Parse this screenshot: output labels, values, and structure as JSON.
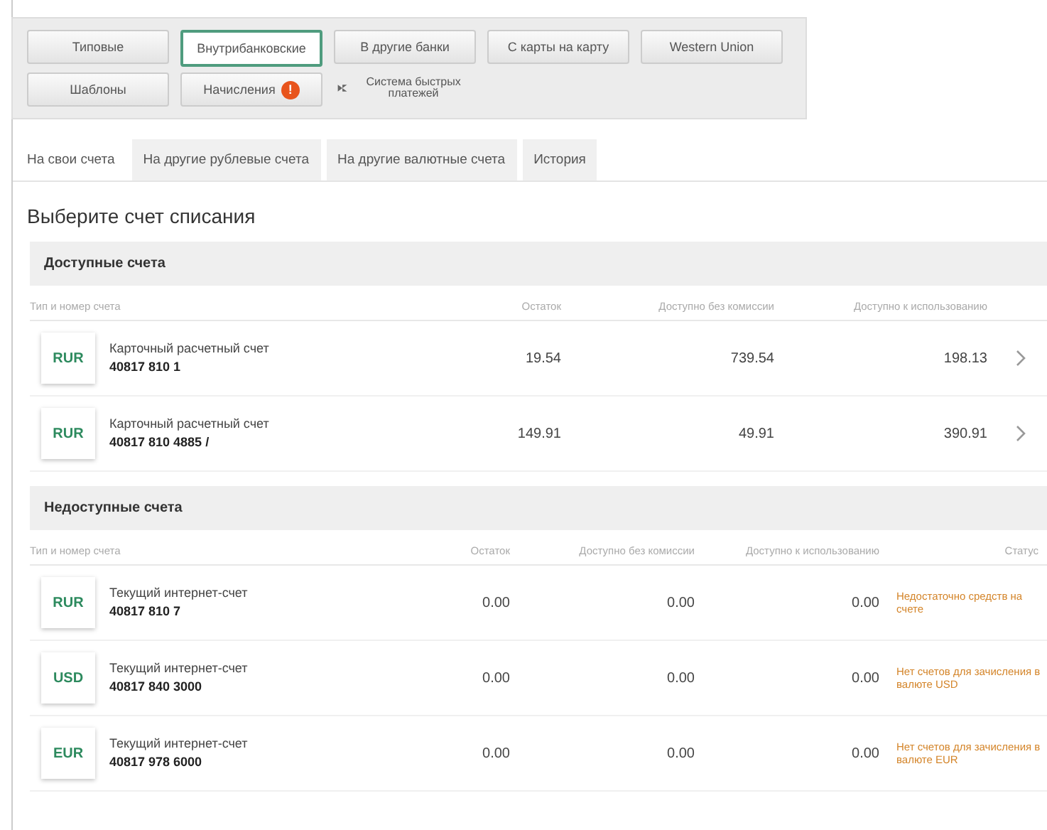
{
  "transfer_types": [
    {
      "label": "Типовые",
      "selected": false
    },
    {
      "label": "Внутрибанковские",
      "selected": true
    },
    {
      "label": "В другие банки",
      "selected": false
    },
    {
      "label": "С карты на карту",
      "selected": false
    },
    {
      "label": "Western Union",
      "selected": false
    },
    {
      "label": "Шаблоны",
      "selected": false
    },
    {
      "label": "Начисления",
      "selected": false,
      "badge": "!"
    },
    {
      "label": "Система быстрых платежей",
      "selected": false,
      "kind": "sbp"
    }
  ],
  "tabs": [
    {
      "label": "На свои счета",
      "selected": true
    },
    {
      "label": "На другие рублевые счета",
      "selected": false
    },
    {
      "label": "На другие валютные счета",
      "selected": false
    },
    {
      "label": "История",
      "selected": false
    }
  ],
  "heading": "Выберите счет списания",
  "sections": [
    {
      "title": "Доступные счета",
      "kind": "available",
      "columns": [
        "Тип и номер счета",
        "Остаток",
        "Доступно без комиссии",
        "Доступно к использованию"
      ],
      "rows": [
        {
          "currency": "RUR",
          "name": "Карточный расчетный счет",
          "number": "40817 810 1",
          "balance": "19.54",
          "no_fee": "739.54",
          "usable": "198.13"
        },
        {
          "currency": "RUR",
          "name": "Карточный расчетный счет",
          "number": "40817 810 4885 /",
          "balance": "149.91",
          "no_fee": "49.91",
          "usable": "390.91"
        }
      ]
    },
    {
      "title": "Недоступные счета",
      "kind": "unavailable",
      "columns": [
        "Тип и номер счета",
        "Остаток",
        "Доступно без комиссии",
        "Доступно к использованию",
        "Статус"
      ],
      "rows": [
        {
          "currency": "RUR",
          "name": "Текущий интернет-счет",
          "number": "40817 810 7",
          "balance": "0.00",
          "no_fee": "0.00",
          "usable": "0.00",
          "status": "Недостаточно средств на счете"
        },
        {
          "currency": "USD",
          "name": "Текущий интернет-счет",
          "number": "40817 840 3000",
          "balance": "0.00",
          "no_fee": "0.00",
          "usable": "0.00",
          "status": "Нет счетов для зачисления в валюте USD"
        },
        {
          "currency": "EUR",
          "name": "Текущий интернет-счет",
          "number": "40817 978 6000",
          "balance": "0.00",
          "no_fee": "0.00",
          "usable": "0.00",
          "status": "Нет счетов для зачисления в валюте EUR"
        }
      ]
    }
  ]
}
